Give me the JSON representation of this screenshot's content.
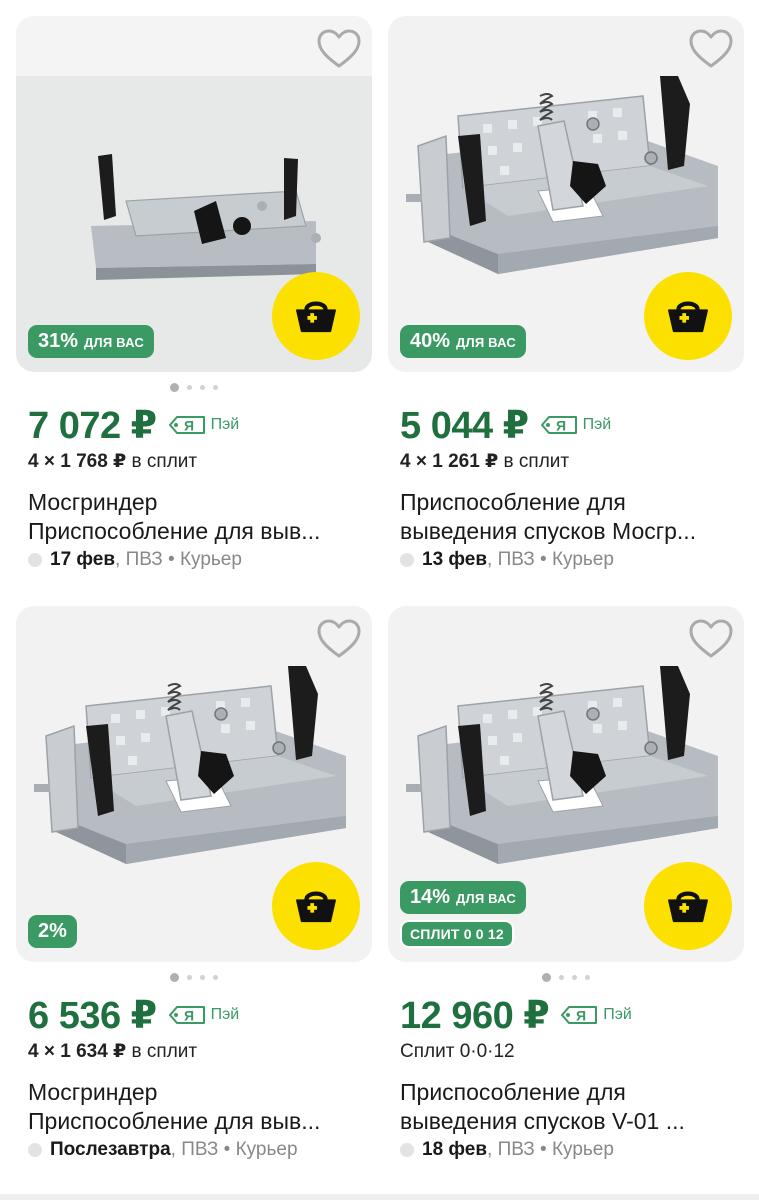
{
  "products": [
    {
      "discount": "31%",
      "discount_label": "ДЛЯ ВАС",
      "price": "7 072 ₽",
      "pay_label": "Пэй",
      "installment_count": "4 × 1 768 ₽",
      "installment_suffix": "в сплит",
      "title_line1": "Мосгриндер",
      "title_line2": "Приспособление для выв...",
      "delivery_date": "17 фев",
      "delivery_rest": ", ПВЗ • Курьер",
      "photo_dots": 4,
      "active_dot": 0
    },
    {
      "discount": "40%",
      "discount_label": "ДЛЯ ВАС",
      "price": "5 044 ₽",
      "pay_label": "Пэй",
      "installment_count": "4 × 1 261 ₽",
      "installment_suffix": "в сплит",
      "title_line1": "Приспособление для",
      "title_line2": "выведения спусков Мосгр...",
      "delivery_date": "13 фев",
      "delivery_rest": ", ПВЗ • Курьер"
    },
    {
      "discount": "2%",
      "price": "6 536 ₽",
      "pay_label": "Пэй",
      "installment_count": "4 × 1 634 ₽",
      "installment_suffix": "в сплит",
      "title_line1": "Мосгриндер",
      "title_line2": "Приспособление для выв...",
      "delivery_date": "Послезавтра",
      "delivery_rest": ", ПВЗ • Курьер",
      "photo_dots": 4,
      "active_dot": 0
    },
    {
      "discount": "14%",
      "discount_label": "ДЛЯ ВАС",
      "split_badge": "СПЛИТ 0 0 12",
      "price": "12 960 ₽",
      "pay_label": "Пэй",
      "installment_text": "Сплит 0·0·12",
      "title_line1": "Приспособление для",
      "title_line2": "выведения спусков V-01 ...",
      "delivery_date": "18 фев",
      "delivery_rest": ", ПВЗ • Курьер",
      "photo_dots": 4,
      "active_dot": 0
    }
  ],
  "icons": {
    "favorite": "heart-outline-icon",
    "cart": "basket-plus-icon",
    "pay": "ya-pay-icon"
  },
  "colors": {
    "price_green": "#1f6f3f",
    "badge_green": "#3b9a63",
    "cart_yellow": "#fce000"
  }
}
